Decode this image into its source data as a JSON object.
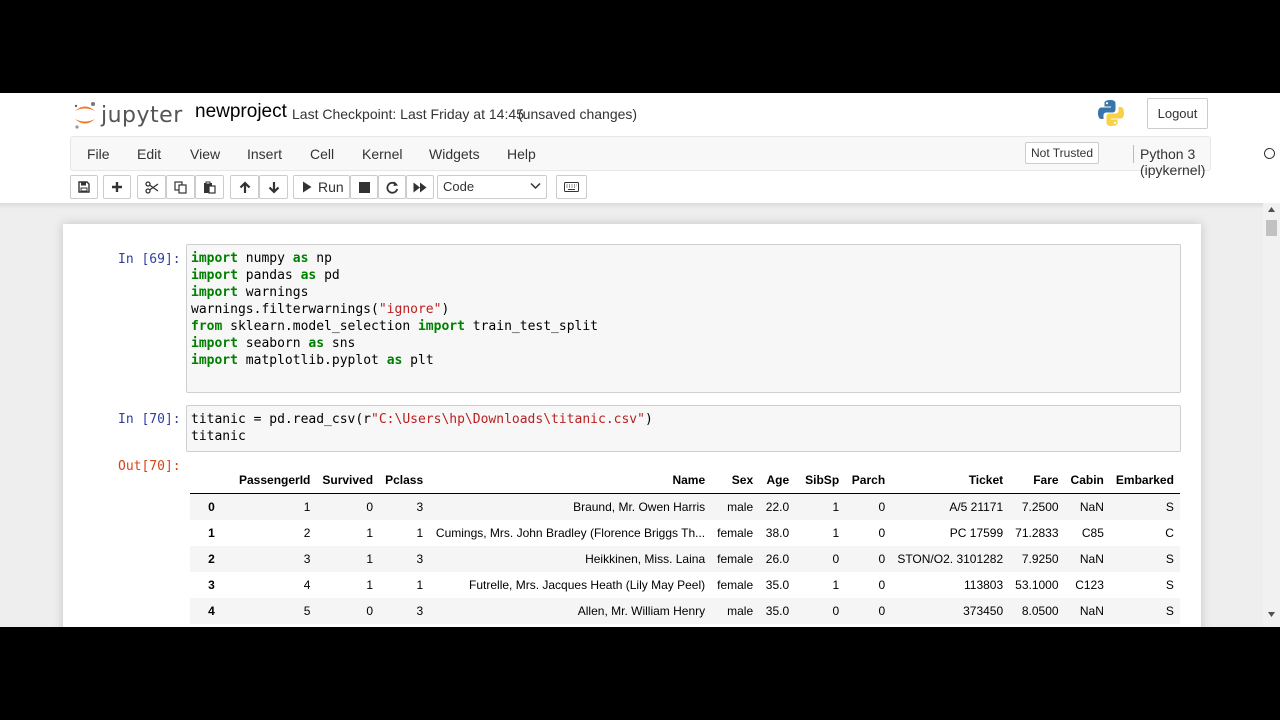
{
  "header": {
    "logo_text": "jupyter",
    "notebook_name": "newproject",
    "checkpoint": "Last Checkpoint: Last Friday at 14:45",
    "unsaved": "(unsaved changes)",
    "logout_label": "Logout"
  },
  "menubar": {
    "items": [
      "File",
      "Edit",
      "View",
      "Insert",
      "Cell",
      "Kernel",
      "Widgets",
      "Help"
    ],
    "trust_label": "Not Trusted",
    "kernel_name": "Python 3 (ipykernel)"
  },
  "toolbar": {
    "buttons": [
      "save-icon",
      "add-cell-icon",
      "cut-icon",
      "copy-icon",
      "paste-icon",
      "move-up-icon",
      "move-down-icon",
      "run-icon",
      "stop-icon",
      "restart-icon",
      "fast-forward-icon",
      "keyboard-icon"
    ],
    "run_label": "Run",
    "cell_type": "Code"
  },
  "cells": [
    {
      "prompt": "In [69]:",
      "lines": [
        "import numpy as np",
        "import pandas as pd",
        "import warnings",
        "warnings.filterwarnings(\"ignore\")",
        "from sklearn.model_selection import train_test_split",
        "import seaborn as sns",
        "import matplotlib.pyplot as plt"
      ]
    },
    {
      "prompt": "In [70]:",
      "lines": [
        "titanic = pd.read_csv(r\"C:\\Users\\hp\\Downloads\\titanic.csv\")",
        "titanic"
      ],
      "output_prompt": "Out[70]:"
    }
  ],
  "dataframe": {
    "columns": [
      "",
      "PassengerId",
      "Survived",
      "Pclass",
      "Name",
      "Sex",
      "Age",
      "SibSp",
      "Parch",
      "Ticket",
      "Fare",
      "Cabin",
      "Embarked"
    ],
    "rows": [
      [
        "0",
        "1",
        "0",
        "3",
        "Braund, Mr. Owen Harris",
        "male",
        "22.0",
        "1",
        "0",
        "A/5 21171",
        "7.2500",
        "NaN",
        "S"
      ],
      [
        "1",
        "2",
        "1",
        "1",
        "Cumings, Mrs. John Bradley (Florence Briggs Th...",
        "female",
        "38.0",
        "1",
        "0",
        "PC 17599",
        "71.2833",
        "C85",
        "C"
      ],
      [
        "2",
        "3",
        "1",
        "3",
        "Heikkinen, Miss. Laina",
        "female",
        "26.0",
        "0",
        "0",
        "STON/O2. 3101282",
        "7.9250",
        "NaN",
        "S"
      ],
      [
        "3",
        "4",
        "1",
        "1",
        "Futrelle, Mrs. Jacques Heath (Lily May Peel)",
        "female",
        "35.0",
        "1",
        "0",
        "113803",
        "53.1000",
        "C123",
        "S"
      ],
      [
        "4",
        "5",
        "0",
        "3",
        "Allen, Mr. William Henry",
        "male",
        "35.0",
        "0",
        "0",
        "373450",
        "8.0500",
        "NaN",
        "S"
      ]
    ]
  },
  "colors": {
    "in_prompt": "#303f9f",
    "out_prompt": "#d84315",
    "keyword": "#008000",
    "string": "#ba2121"
  }
}
